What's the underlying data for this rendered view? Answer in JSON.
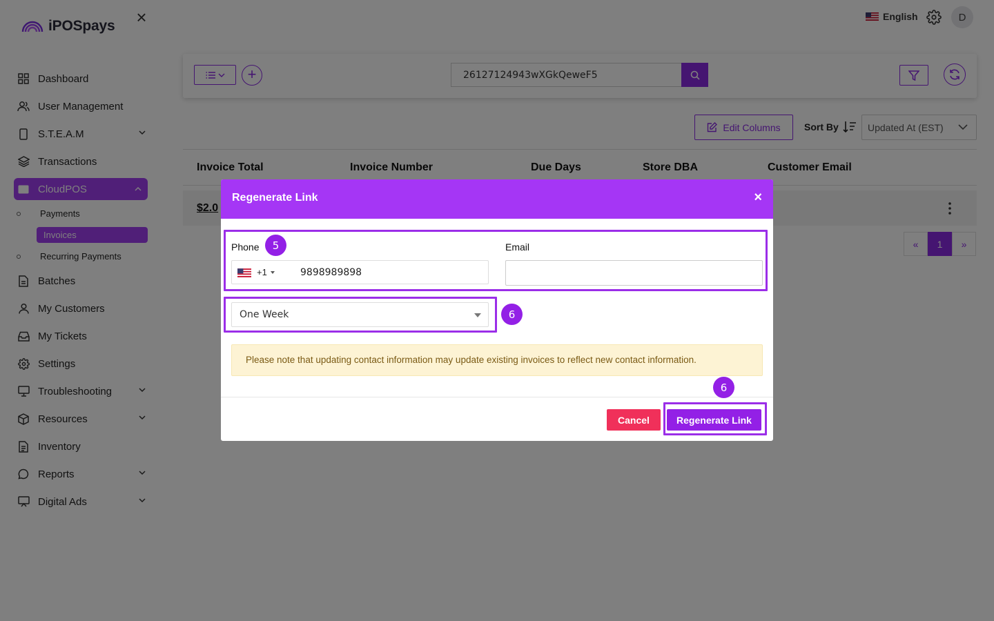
{
  "brand": {
    "name": "iPOSpays"
  },
  "sidebar": {
    "items": [
      {
        "label": "Dashboard",
        "icon": "dashboard-icon"
      },
      {
        "label": "User Management",
        "icon": "users-icon"
      },
      {
        "label": "S.T.E.A.M",
        "icon": "phone-icon",
        "expandable": true
      },
      {
        "label": "Transactions",
        "icon": "layers-icon"
      },
      {
        "label": "CloudPOS",
        "icon": "card-icon",
        "expandable": true,
        "active": true,
        "children": [
          {
            "label": "Payments"
          },
          {
            "label": "Invoices",
            "active": true
          },
          {
            "label": "Recurring Payments"
          }
        ]
      },
      {
        "label": "Batches",
        "icon": "document-icon"
      },
      {
        "label": "My Customers",
        "icon": "user-icon"
      },
      {
        "label": "My Tickets",
        "icon": "inbox-icon"
      },
      {
        "label": "Settings",
        "icon": "gear-icon"
      },
      {
        "label": "Troubleshooting",
        "icon": "monitor-icon",
        "expandable": true
      },
      {
        "label": "Resources",
        "icon": "box-icon",
        "expandable": true
      },
      {
        "label": "Inventory",
        "icon": "file-icon"
      },
      {
        "label": "Reports",
        "icon": "chat-icon",
        "expandable": true
      },
      {
        "label": "Digital Ads",
        "icon": "screen-icon",
        "expandable": true
      }
    ]
  },
  "topbar": {
    "language": "English",
    "avatar_initial": "D"
  },
  "toolbar": {
    "search_value": "26127124943wXGkQeweF5"
  },
  "table_controls": {
    "edit_columns_label": "Edit Columns",
    "sort_by_label": "Sort By",
    "sort_value": "Updated At (EST)"
  },
  "table": {
    "columns": [
      "Invoice Total",
      "Invoice Number",
      "Due Days",
      "Store DBA",
      "Customer Email"
    ],
    "rows": [
      {
        "amount": "$2.0"
      }
    ]
  },
  "pagination": {
    "prev": "«",
    "current": "1",
    "next": "»"
  },
  "modal": {
    "title": "Regenerate Link",
    "close": "×",
    "phone_label": "Phone",
    "phone_country_code": "+1",
    "phone_number": "9898989898",
    "email_label": "Email",
    "email_value": "",
    "expiry_value": "One Week",
    "notice": "Please note that updating contact information may update existing invoices to reflect new contact information.",
    "cancel_label": "Cancel",
    "regenerate_label": "Regenerate Link"
  },
  "annotations": {
    "step_phone": "5",
    "step_expiry": "6",
    "step_regenerate": "6"
  },
  "colors": {
    "accent": "#a536f5",
    "brand_purple": "#8a2be2",
    "cancel": "#f0305a",
    "notice_bg": "#fdf3d4"
  }
}
